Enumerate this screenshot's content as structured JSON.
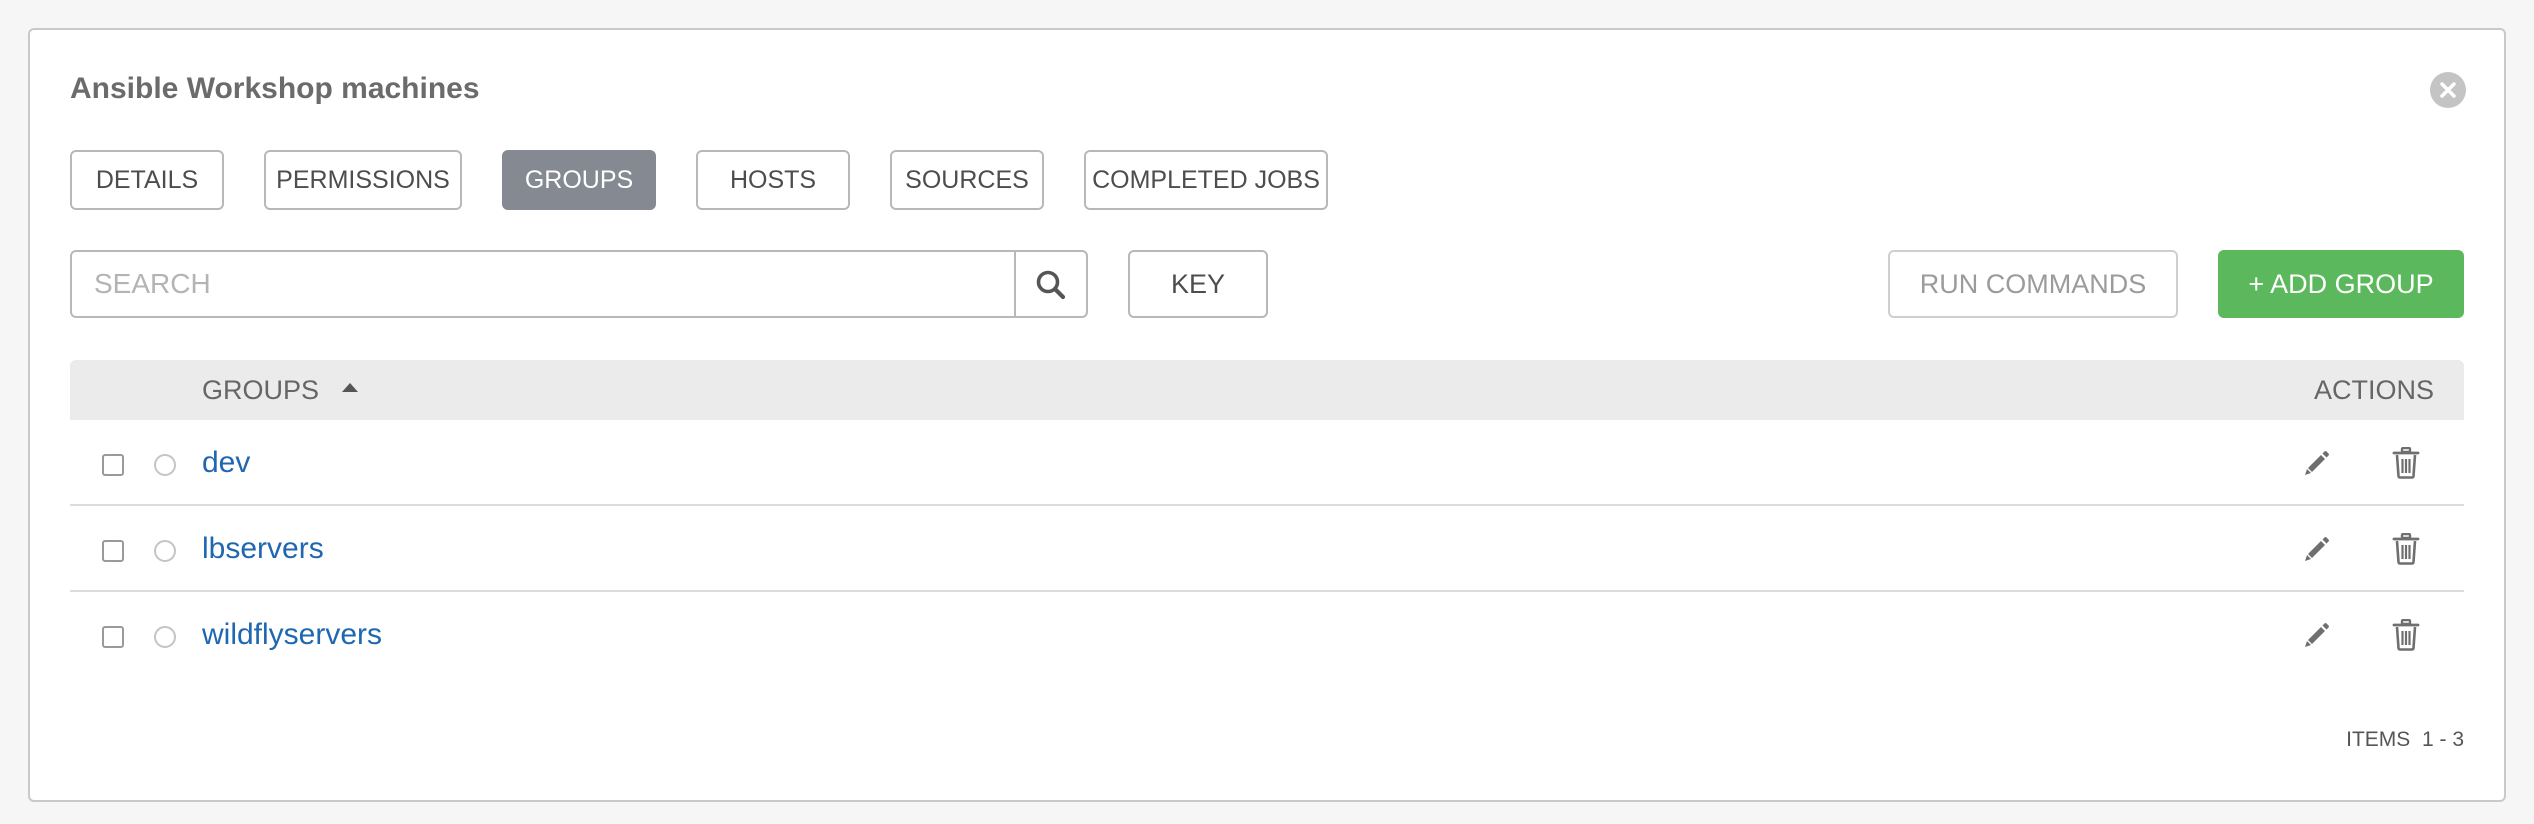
{
  "panel": {
    "title": "Ansible Workshop machines"
  },
  "tabs": [
    {
      "label": "DETAILS",
      "active": false
    },
    {
      "label": "PERMISSIONS",
      "active": false
    },
    {
      "label": "GROUPS",
      "active": true
    },
    {
      "label": "HOSTS",
      "active": false
    },
    {
      "label": "SOURCES",
      "active": false
    },
    {
      "label": "COMPLETED JOBS",
      "active": false
    }
  ],
  "search": {
    "placeholder": "SEARCH",
    "value": ""
  },
  "toolbar": {
    "key_label": "KEY",
    "run_commands_label": "RUN COMMANDS",
    "add_group_label": "+ ADD GROUP"
  },
  "table": {
    "columns": {
      "groups": "GROUPS",
      "actions": "ACTIONS"
    },
    "rows": [
      {
        "name": "dev"
      },
      {
        "name": "lbservers"
      },
      {
        "name": "wildflyservers"
      }
    ]
  },
  "pagination": {
    "items_label": "ITEMS  1 - 3"
  },
  "icons": {
    "close": "close-icon",
    "search": "search-icon",
    "sort": "sort-ascending-icon",
    "edit": "pencil-icon",
    "delete": "trash-icon"
  },
  "colors": {
    "active_tab": "#848992",
    "add_button": "#5cb85c",
    "link": "#1f67b1"
  }
}
